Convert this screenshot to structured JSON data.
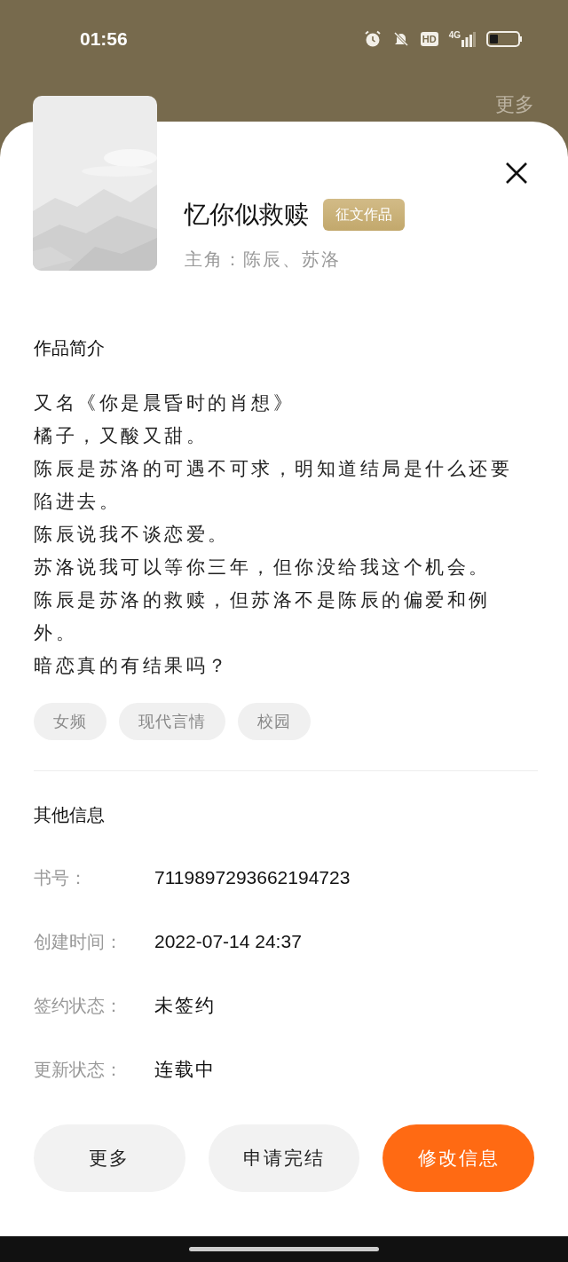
{
  "status_bar": {
    "time": "01:56",
    "hd": "HD",
    "network": "4G"
  },
  "background_header": {
    "more": "更多"
  },
  "cover": {
    "kind": "picture"
  },
  "book": {
    "title": "忆你似救赎",
    "badge": "征文作品",
    "characters": "主角：陈辰、苏洛"
  },
  "synopsis": {
    "heading": "作品简介",
    "paragraphs": [
      "又名《你是晨昏时的肖想》",
      "橘子，又酸又甜。",
      "陈辰是苏洛的可遇不可求，明知道结局是什么还要陷进去。",
      "陈辰说我不谈恋爱。",
      "苏洛说我可以等你三年，但你没给我这个机会。",
      "陈辰是苏洛的救赎，但苏洛不是陈辰的偏爱和例外。",
      "暗恋真的有结果吗？"
    ]
  },
  "tags": [
    "女频",
    "现代言情",
    "校园"
  ],
  "other_info": {
    "heading": "其他信息",
    "rows": [
      {
        "label": "书号：",
        "value": "7119897293662194723",
        "kind": "number"
      },
      {
        "label": "创建时间：",
        "value": "2022-07-14 24:37",
        "kind": "number"
      },
      {
        "label": "签约状态：",
        "value": "未签约",
        "kind": "text"
      },
      {
        "label": "更新状态：",
        "value": "连载中",
        "kind": "text"
      }
    ]
  },
  "buttons": [
    {
      "label": "更多",
      "kind": "secondary"
    },
    {
      "label": "申请完结",
      "kind": "secondary"
    },
    {
      "label": "修改信息",
      "kind": "primary"
    }
  ]
}
